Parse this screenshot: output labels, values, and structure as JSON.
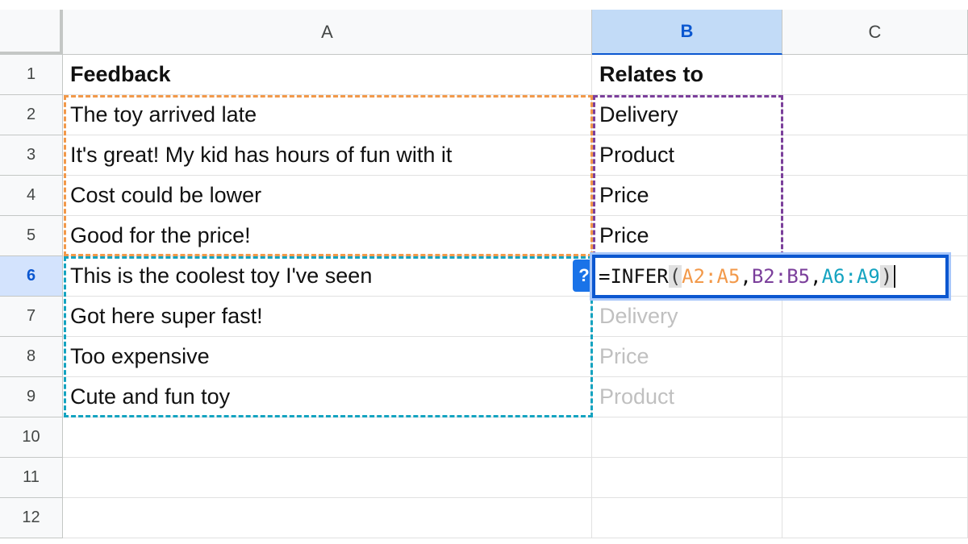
{
  "columns": [
    "A",
    "B",
    "C"
  ],
  "rows": [
    "1",
    "2",
    "3",
    "4",
    "5",
    "6",
    "7",
    "8",
    "9",
    "10",
    "11",
    "12"
  ],
  "cells": {
    "A": [
      "Feedback",
      "The toy arrived late",
      "It's great! My kid has hours of fun with it",
      "Cost could be lower",
      "Good for the price!",
      "This is the coolest toy I've seen",
      "Got here super fast!",
      "Too expensive",
      "Cute and fun toy",
      "",
      "",
      ""
    ],
    "B": [
      "Relates to",
      "Delivery",
      "Product",
      "Price",
      "Price",
      "",
      "Delivery",
      "Price",
      "Product",
      "",
      "",
      ""
    ]
  },
  "selected_column": "B",
  "selected_row": "6",
  "formula": {
    "equals": "=",
    "function": "INFER",
    "open_paren": "(",
    "arg1": "A2:A5",
    "comma1": ",",
    "arg2": "B2:B5",
    "comma2": ",",
    "arg3": "A6:A9",
    "close_paren": ")"
  },
  "help_icon_label": "?",
  "colors": {
    "range_training_input": "#f2994a",
    "range_training_output": "#7b3f9b",
    "range_target_input": "#14a3c0",
    "selection": "#0b57d0"
  }
}
